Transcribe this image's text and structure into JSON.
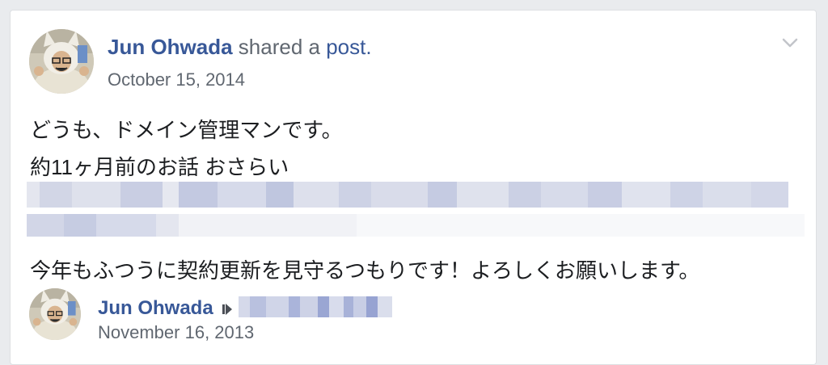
{
  "post": {
    "author": "Jun Ohwada",
    "action_text": " shared a ",
    "post_link": "post",
    "period": ".",
    "date": "October 15, 2014",
    "lines": [
      "どうも、ドメイン管理マンです。",
      "約11ヶ月前のお話 おさらい",
      "今年もふつうに契約更新を見守るつもりです！よろしくお願いします。"
    ]
  },
  "shared_post": {
    "author": "Jun Ohwada",
    "date": "November 16, 2013"
  },
  "icons": {
    "menu": "chevron-down-icon",
    "share_target": "caret-right-icon"
  },
  "colors": {
    "link": "#385898",
    "meta": "#606770",
    "text": "#1c1e21",
    "background": "#e9ebee"
  }
}
